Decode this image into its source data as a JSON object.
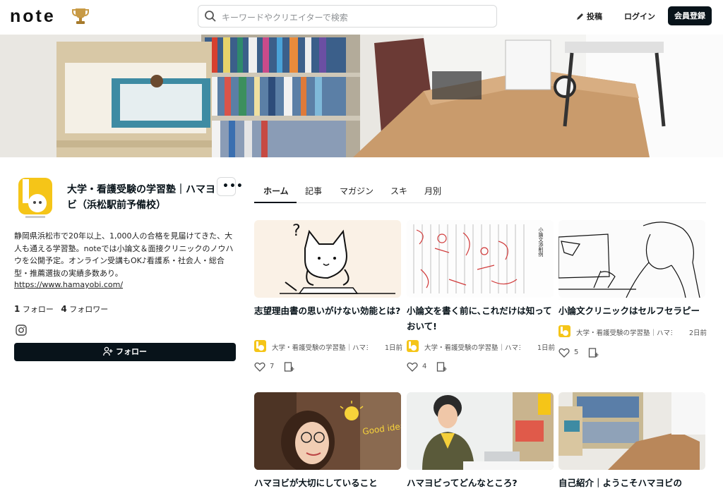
{
  "header": {
    "logo": "note",
    "search_placeholder": "キーワードやクリエイターで検索",
    "post_label": "投稿",
    "login_label": "ログイン",
    "signup_label": "会員登録"
  },
  "profile": {
    "name": "大学・看護受験の学習塾｜ハマヨビ（浜松駅前予備校）",
    "bio": "静岡県浜松市で20年以上、1,000人の合格を見届けてきた、大人も通える学習塾。noteでは小論文＆面接クリニックのノウハウを公開予定。オンライン受講もOK♪看護系・社会人・総合型・推薦選抜の実績多数あり。",
    "url": "https://www.hamayobi.com/",
    "follow_count": "1",
    "follow_label": "フォロー",
    "follower_count": "4",
    "follower_label": "フォロワー",
    "follow_button": "フォロー"
  },
  "tabs": [
    "ホーム",
    "記事",
    "マガジン",
    "スキ",
    "月別"
  ],
  "articles": [
    {
      "title": "志望理由書の思いがけない効能とは?",
      "author": "大学・看護受験の学習塾｜ハマヨビ（浜松駅前予備校）",
      "time": "1日前",
      "likes": "7"
    },
    {
      "title": "小論文を書く前に､これだけは知っておいて!",
      "author": "大学・看護受験の学習塾｜ハマヨビ（浜松駅前予備校）",
      "time": "1日前",
      "likes": "4"
    },
    {
      "title": "小論文クリニックはセルフセラピー",
      "author": "大学・看護受験の学習塾｜ハマヨビ（浜松駅前予備校）",
      "time": "2日前",
      "likes": "5"
    },
    {
      "title": "ハマヨビが大切にしていること"
    },
    {
      "title": "ハマヨビってどんなところ?"
    },
    {
      "title": "自己紹介｜ようこそハマヨビの"
    }
  ],
  "thumb_text": {
    "idea": "Good idea!",
    "paper_heading": "小論文添削例"
  },
  "colors": {
    "primary": "#08131a",
    "brand_yellow": "#f5c518"
  }
}
